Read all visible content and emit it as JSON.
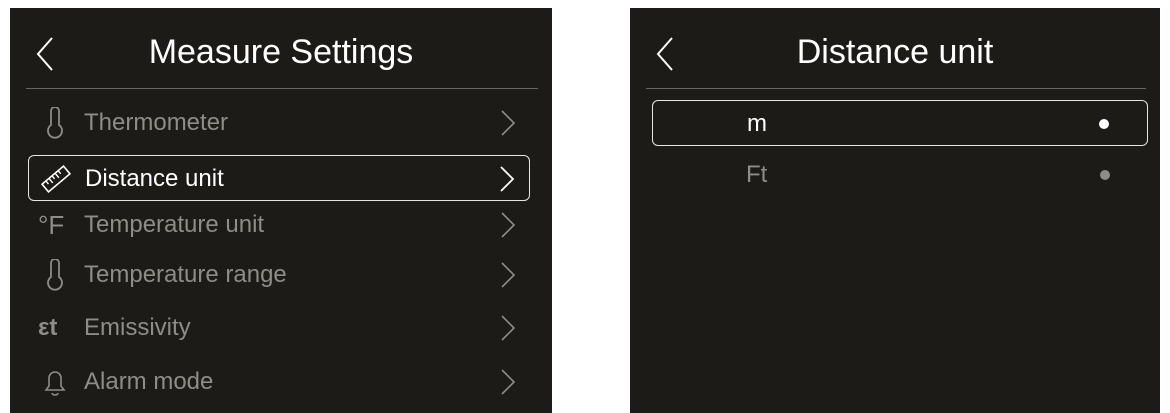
{
  "left_screen": {
    "title": "Measure Settings",
    "items": [
      {
        "label": "Thermometer",
        "icon": "thermometer-icon"
      },
      {
        "label": "Distance unit",
        "icon": "ruler-icon",
        "selected": true
      },
      {
        "label": "Temperature unit",
        "icon": "fahrenheit-icon",
        "icon_text": "°F"
      },
      {
        "label": "Temperature range",
        "icon": "thermometer-icon"
      },
      {
        "label": "Emissivity",
        "icon": "emissivity-icon",
        "icon_text": "εt"
      },
      {
        "label": "Alarm mode",
        "icon": "bell-icon"
      }
    ]
  },
  "right_screen": {
    "title": "Distance unit",
    "options": [
      {
        "label": "m",
        "selected": true
      },
      {
        "label": "Ft",
        "selected": false
      }
    ]
  },
  "colors": {
    "screen_bg": "#1d1b18",
    "active_text": "#ffffff",
    "inactive_text": "#8e8c86",
    "divider": "#6a6862"
  }
}
